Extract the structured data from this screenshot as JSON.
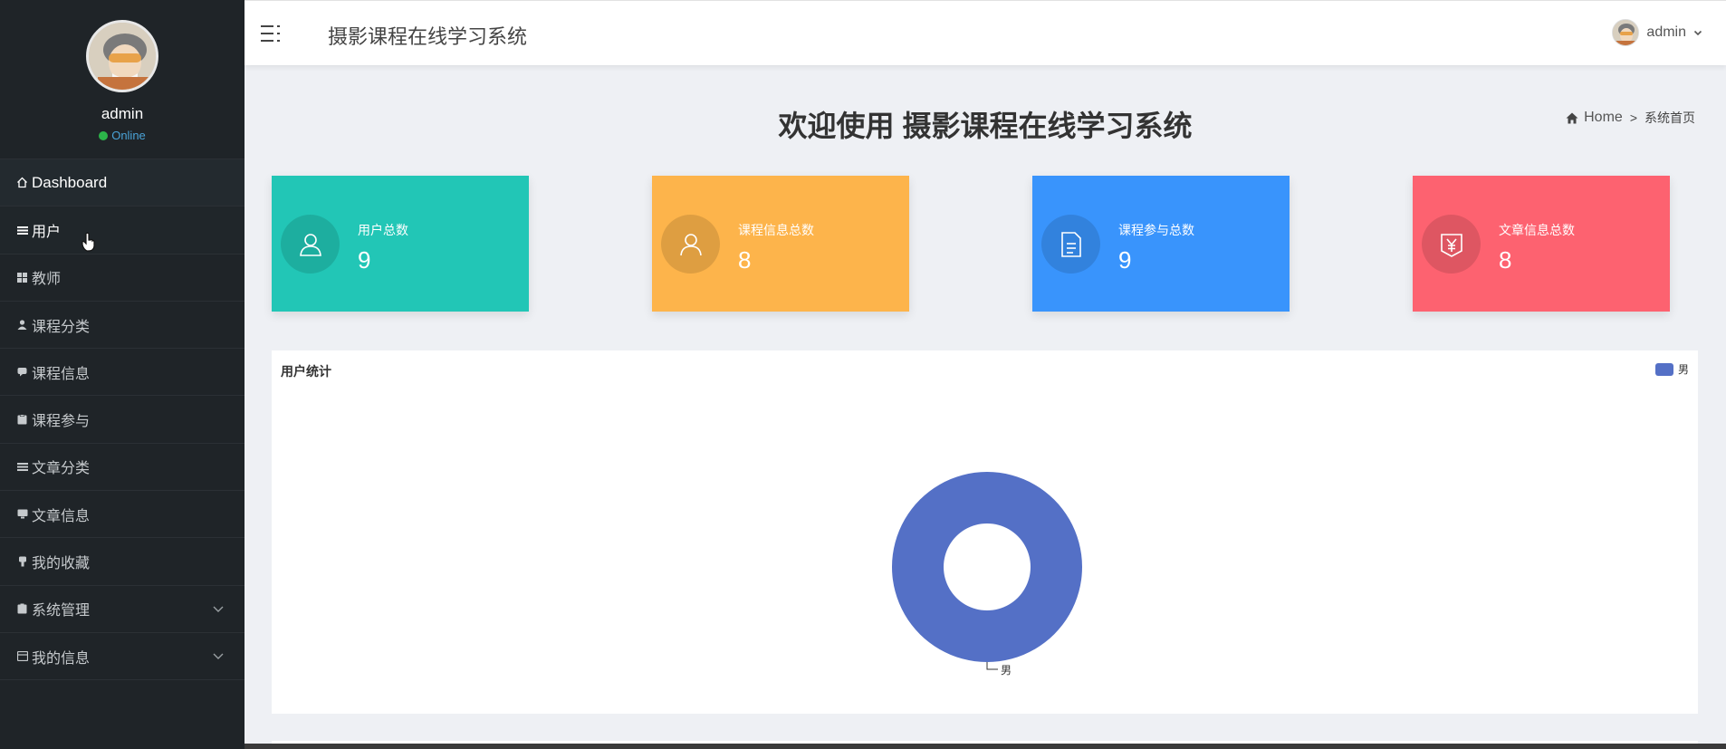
{
  "sidebar": {
    "username": "admin",
    "status": "Online",
    "items": [
      {
        "label": "Dashboard",
        "icon": "home-icon"
      },
      {
        "label": "用户",
        "icon": "list-icon"
      },
      {
        "label": "教师",
        "icon": "grid-icon"
      },
      {
        "label": "课程分类",
        "icon": "person-icon"
      },
      {
        "label": "课程信息",
        "icon": "comment-icon"
      },
      {
        "label": "课程参与",
        "icon": "clipboard-icon"
      },
      {
        "label": "文章分类",
        "icon": "list-icon"
      },
      {
        "label": "文章信息",
        "icon": "monitor-icon"
      },
      {
        "label": "我的收藏",
        "icon": "bookmark-icon"
      },
      {
        "label": "系统管理",
        "icon": "clipboard-icon"
      },
      {
        "label": "我的信息",
        "icon": "card-icon"
      }
    ]
  },
  "topbar": {
    "title": "摄影课程在线学习系统",
    "user": "admin"
  },
  "main": {
    "welcome": "欢迎使用 摄影课程在线学习系统",
    "breadcrumb": {
      "home": "Home",
      "separator": ">",
      "current": "系统首页"
    },
    "cards": [
      {
        "label": "用户总数",
        "value": "9",
        "color": "#22c6b6",
        "icon": "user-icon"
      },
      {
        "label": "课程信息总数",
        "value": "8",
        "color": "#fdb44b",
        "icon": "user-icon"
      },
      {
        "label": "课程参与总数",
        "value": "9",
        "color": "#3994fc",
        "icon": "document-icon"
      },
      {
        "label": "文章信息总数",
        "value": "8",
        "color": "#fd6270",
        "icon": "yen-icon"
      }
    ],
    "panel": {
      "title": "用户统计"
    }
  },
  "chart_data": {
    "type": "pie",
    "title": "用户统计",
    "categories": [
      "男"
    ],
    "values": [
      9
    ],
    "series": [
      {
        "name": "男",
        "values": [
          9
        ]
      }
    ],
    "colors": [
      "#5470c6"
    ],
    "legend": "top-right"
  }
}
